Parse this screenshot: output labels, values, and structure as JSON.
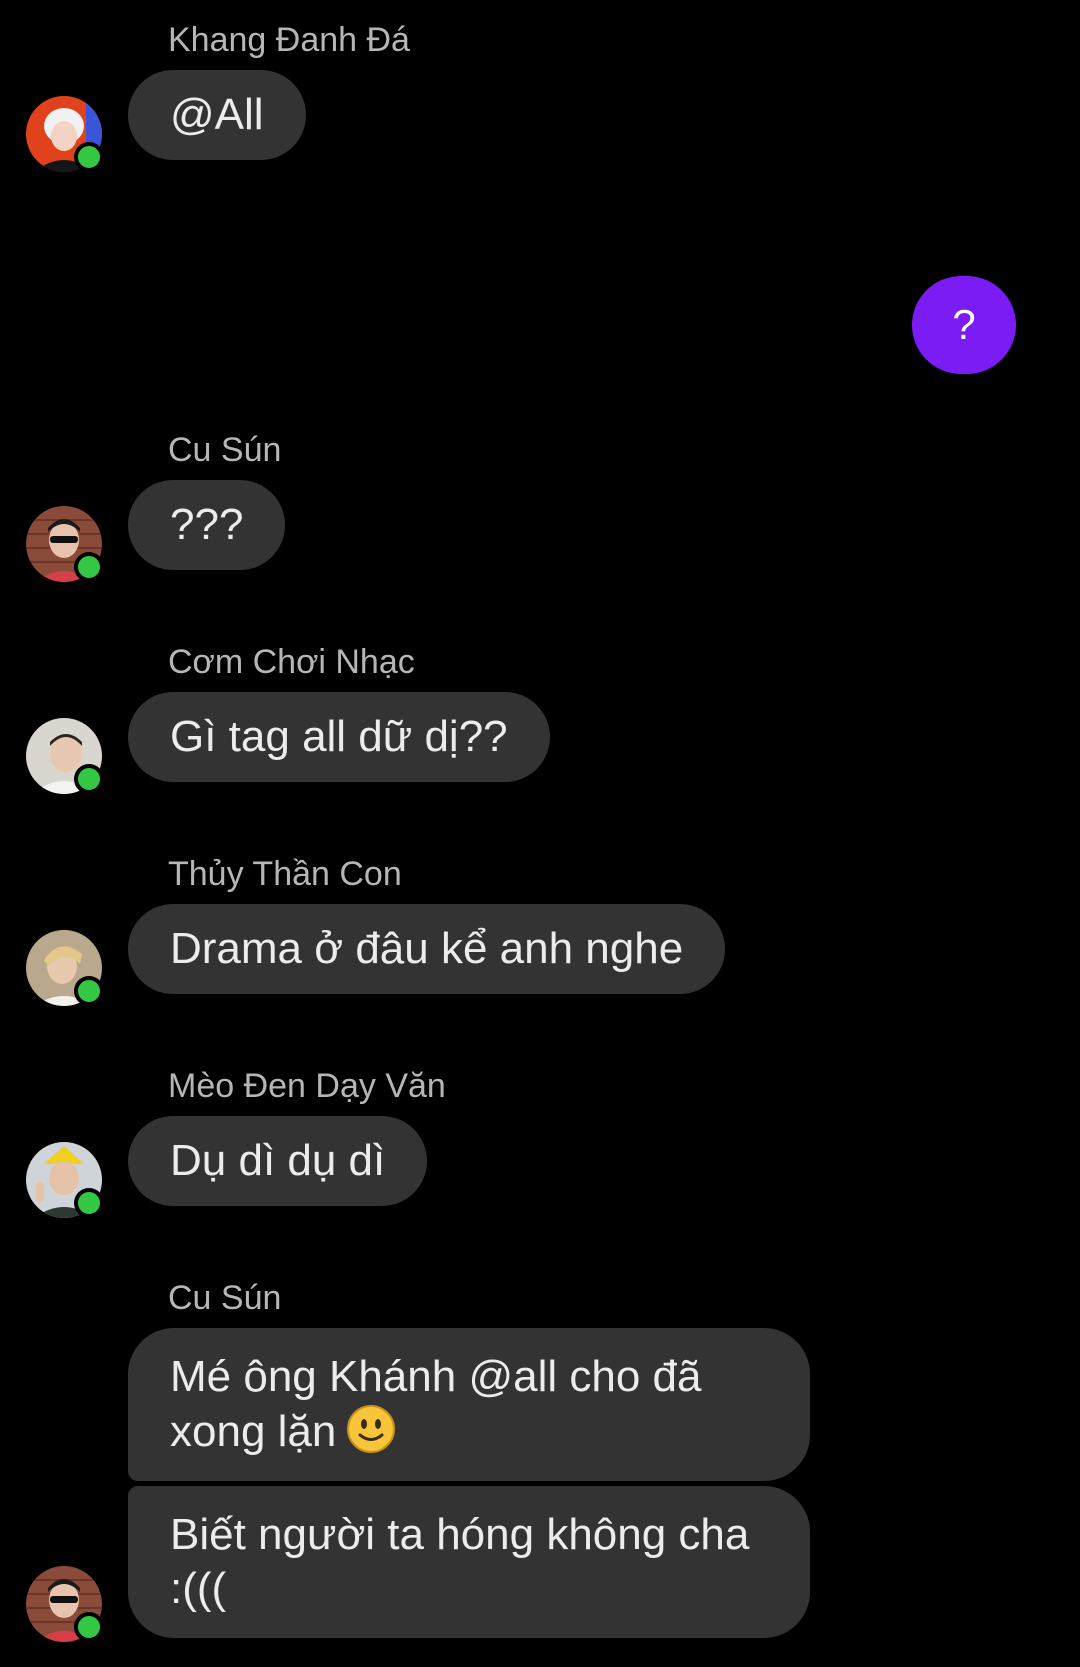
{
  "colors": {
    "background": "#000000",
    "bubble_incoming": "#333333",
    "bubble_outgoing": "#7b1cf5",
    "online_indicator": "#34c744",
    "sender_text": "#b6b6b6"
  },
  "messages": [
    {
      "sender": "Khang Đanh Đá",
      "avatar_icon": "avatar-khang",
      "online": true,
      "bubbles": [
        "@All"
      ]
    },
    {
      "outgoing": true,
      "bubbles": [
        "?"
      ]
    },
    {
      "sender": "Cu Sún",
      "avatar_icon": "avatar-cu-sun",
      "online": true,
      "bubbles": [
        "???"
      ]
    },
    {
      "sender": "Cơm Chơi Nhạc",
      "avatar_icon": "avatar-com-choi-nhac",
      "online": true,
      "bubbles": [
        "Gì tag all dữ dị??"
      ]
    },
    {
      "sender": "Thủy Thần Con",
      "avatar_icon": "avatar-thuy-than-con",
      "online": true,
      "bubbles": [
        "Drama ở đâu kể anh nghe"
      ]
    },
    {
      "sender": "Mèo Đen Dạy Văn",
      "avatar_icon": "avatar-meo-den-day-van",
      "online": true,
      "bubbles": [
        "Dụ dì dụ dì"
      ]
    },
    {
      "sender": "Cu Sún",
      "avatar_icon": "avatar-cu-sun",
      "online": true,
      "bubbles": [
        "Mé ông Khánh @all cho đã xong lặn",
        "Biết người ta hóng không cha :((("
      ],
      "emoji_after_first": "slightly-smiling-face-emoji"
    }
  ]
}
